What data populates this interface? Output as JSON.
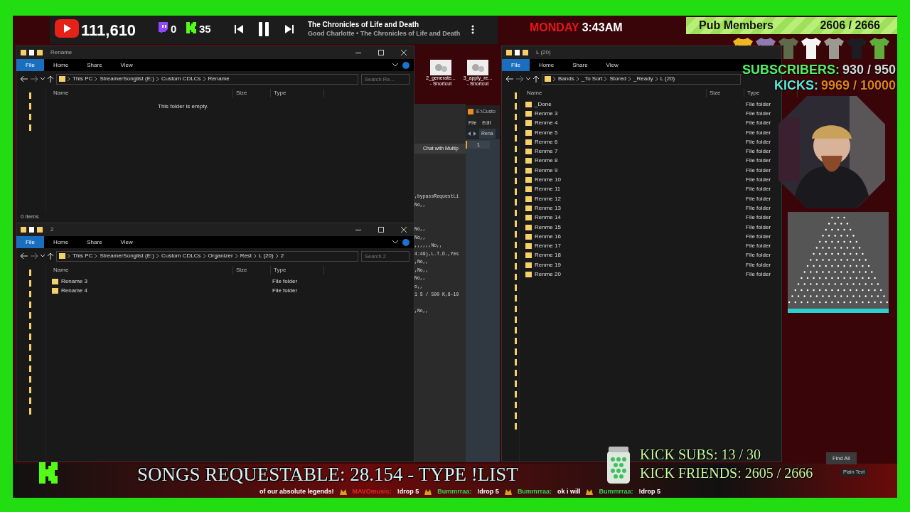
{
  "now_playing": {
    "youtube_count": "111,610",
    "twitch_count": "0",
    "kick_count": "35",
    "title": "The Chronicles of Life and Death",
    "artist": "Good Charlotte • The Chronicles of Life and Death",
    "playing": true
  },
  "clock": {
    "day": "MONDAY",
    "time": "3:43AM"
  },
  "goal": {
    "label": "Pub Members",
    "count": "2606 / 2666"
  },
  "tshirts": [
    {
      "color": "#f0b81c"
    },
    {
      "color": "#8e7bb0"
    },
    {
      "color": "#5d6b4a"
    },
    {
      "color": "#f4f4f4"
    },
    {
      "color": "#9a9a92"
    },
    {
      "color": "#1c1c22"
    },
    {
      "color": "#5fae3c"
    }
  ],
  "counters": [
    {
      "label": "SUBSCRIBERS:",
      "value": "930 / 950",
      "color": "#55ee66"
    },
    {
      "label": "KICKS:",
      "value": "9969 / 10000",
      "color": "#55eedd"
    }
  ],
  "desktop_shortcuts": [
    {
      "line1": "2_generate...",
      "line2": "- Shortcut"
    },
    {
      "line1": "3_apply_re...",
      "line2": "- Shortcut"
    }
  ],
  "explorer_windows": [
    {
      "title": "Rename",
      "tabs": [
        {
          "label": "File",
          "selected": true
        },
        {
          "label": "Home",
          "selected": false
        },
        {
          "label": "Share",
          "selected": false
        },
        {
          "label": "View",
          "selected": false
        }
      ],
      "path": [
        "This PC",
        "StreamerSonglist (E:)",
        "Custom CDLCs",
        "Rename"
      ],
      "search_placeholder": "Search Re...",
      "columns": [
        "Name",
        "Size",
        "Type"
      ],
      "empty_text": "This folder is empty.",
      "status": "0 items"
    },
    {
      "title": "2",
      "tabs": [
        {
          "label": "File",
          "selected": true
        },
        {
          "label": "Home",
          "selected": false
        },
        {
          "label": "Share",
          "selected": false
        },
        {
          "label": "View",
          "selected": false
        }
      ],
      "path": [
        "This PC",
        "StreamerSonglist (E:)",
        "Custom CDLCs",
        "Organizer",
        "Rest",
        "L (20)",
        "2"
      ],
      "search_placeholder": "Search 2",
      "columns": [
        "Name",
        "Size",
        "Type"
      ],
      "items": [
        {
          "name": "Rename 3",
          "type": "File folder"
        },
        {
          "name": "Rename 4",
          "type": "File folder"
        }
      ]
    },
    {
      "title": "L (20)",
      "tabs": [
        {
          "label": "File",
          "selected": true
        },
        {
          "label": "Home",
          "selected": false
        },
        {
          "label": "Share",
          "selected": false
        },
        {
          "label": "View",
          "selected": false
        }
      ],
      "path": [
        "Bands",
        "_To Sort",
        "Stored",
        "_Ready",
        "L (20)"
      ],
      "columns": [
        "Name",
        "Size",
        "Type"
      ],
      "items": [
        {
          "name": "_Done",
          "type": "File folder"
        },
        {
          "name": "Renme 3",
          "type": "File folder"
        },
        {
          "name": "Renme 4",
          "type": "File folder"
        },
        {
          "name": "Renme 5",
          "type": "File folder"
        },
        {
          "name": "Renme 6",
          "type": "File folder"
        },
        {
          "name": "Renme 7",
          "type": "File folder"
        },
        {
          "name": "Renme 8",
          "type": "File folder"
        },
        {
          "name": "Renme 9",
          "type": "File folder"
        },
        {
          "name": "Renme 10",
          "type": "File folder"
        },
        {
          "name": "Renme 11",
          "type": "File folder"
        },
        {
          "name": "Renme 12",
          "type": "File folder"
        },
        {
          "name": "Renme 13",
          "type": "File folder"
        },
        {
          "name": "Renme 14",
          "type": "File folder"
        },
        {
          "name": "Renme 15",
          "type": "File folder"
        },
        {
          "name": "Renme 16",
          "type": "File folder"
        },
        {
          "name": "Renme 17",
          "type": "File folder"
        },
        {
          "name": "Renme 18",
          "type": "File folder"
        },
        {
          "name": "Renme 19",
          "type": "File folder"
        },
        {
          "name": "Renme 20",
          "type": "File folder"
        }
      ],
      "find_all": "Find All",
      "syntax": "Plain Text"
    }
  ],
  "chat_window": {
    "tab": "Chat with Multip",
    "lines": [
      ",bypassRequestLi",
      "No,,",
      "No,,",
      "No,,",
      ",,,,,,No,,",
      "4:49),L.T.D.,Yes",
      ",No,,",
      ",No,,",
      "No,,",
      "o,,",
      "1 S / 500 K,6-10",
      ",No,,"
    ]
  },
  "editor": {
    "title": "E:\\Custo",
    "menu": [
      "File",
      "Edit"
    ],
    "tab": "Rena",
    "line_number": "1"
  },
  "bottom": {
    "songs": "SONGS REQUESTABLE: 28.154 - TYPE !LIST",
    "kick_subs": "KICK SUBS: 13 / 30",
    "kick_friends": "KICK FRIENDS: 2605 / 2666"
  },
  "ticker": [
    {
      "message": "of our absolute legends!"
    },
    {
      "user": "MAVOmusic:",
      "message": "!drop 5",
      "color": "#e02a2a"
    },
    {
      "user": "Bummrraa:",
      "message": "!drop 5",
      "color": "#39d353"
    },
    {
      "user": "Bummrraa:",
      "message": "ok i will",
      "color": "#39d353"
    },
    {
      "user": "Bummrraa:",
      "message": "!drop 5",
      "color": "#39d353"
    }
  ]
}
